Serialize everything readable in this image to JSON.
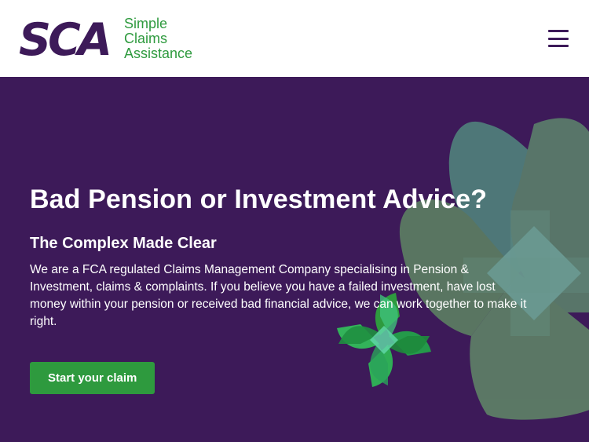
{
  "header": {
    "logo_mark_text": "SCA",
    "logo_lines": [
      "Simple",
      "Claims",
      "Assistance"
    ]
  },
  "hero": {
    "title": "Bad Pension or Investment Advice?",
    "subtitle": "The Complex Made Clear",
    "body": "We are a FCA regulated Claims Management Company specialising in Pension & Investment, claims & complaints. If you believe you have a failed investment, have lost money within your pension or received bad financial advice, we can work together to make it right.",
    "cta_label": "Start your claim"
  },
  "colors": {
    "brand_purple": "#3d1a59",
    "brand_green": "#2e9a3e",
    "header_bg": "#ffffff"
  },
  "icons": {
    "menu": "hamburger-menu-icon"
  }
}
